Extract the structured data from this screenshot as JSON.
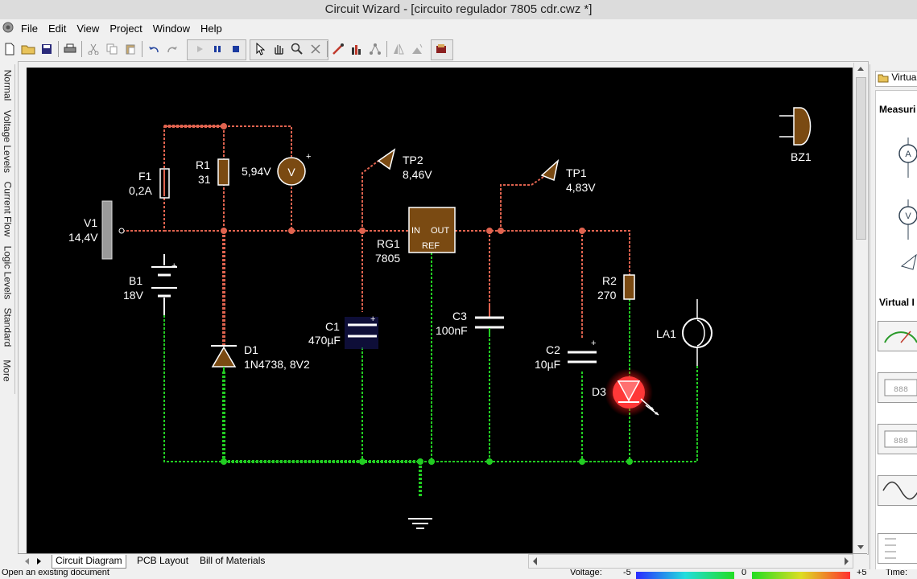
{
  "window": {
    "title": "Circuit Wizard - [circuito regulador 7805 cdr.cwz *]"
  },
  "menu": [
    "File",
    "Edit",
    "View",
    "Project",
    "Window",
    "Help"
  ],
  "left_tabs": [
    "Normal",
    "Voltage Levels",
    "Current Flow",
    "Logic Levels",
    "Standard",
    "More"
  ],
  "sheet_tabs": [
    "Circuit Diagram",
    "PCB Layout",
    "Bill of Materials"
  ],
  "status": {
    "message": "Open an existing document",
    "voltage_label": "Voltage:",
    "scale_min": "-5",
    "scale_mid": "0",
    "scale_max": "+5",
    "time_label": "Time:"
  },
  "right_panel": {
    "header": "Virtual",
    "section_measuring": "Measuri",
    "section_virtual": "Virtual I"
  },
  "circuit": {
    "components": {
      "V1": {
        "name": "V1",
        "value": "14,4V"
      },
      "F1": {
        "name": "F1",
        "value": "0,2A"
      },
      "R1": {
        "name": "R1",
        "value": "31"
      },
      "meter": {
        "reading": "5,94V",
        "symbol": "V"
      },
      "TP2": {
        "name": "TP2",
        "value": "8,46V"
      },
      "TP1": {
        "name": "TP1",
        "value": "4,83V"
      },
      "RG1": {
        "name": "RG1",
        "value": "7805",
        "pin_in": "IN",
        "pin_out": "OUT",
        "pin_ref": "REF"
      },
      "B1": {
        "name": "B1",
        "value": "18V"
      },
      "C1": {
        "name": "C1",
        "value": "470µF"
      },
      "C3": {
        "name": "C3",
        "value": "100nF"
      },
      "C2": {
        "name": "C2",
        "value": "10µF"
      },
      "R2": {
        "name": "R2",
        "value": "270"
      },
      "D1": {
        "name": "D1",
        "value": "1N4738, 8V2"
      },
      "D3": {
        "name": "D3"
      },
      "LA1": {
        "name": "LA1"
      },
      "BZ1": {
        "name": "BZ1"
      }
    }
  },
  "colors": {
    "canvas": "#000000",
    "positive_wire": "#e0634f",
    "ground_wire": "#22cc22",
    "component_brown": "#7a4a12",
    "led_red": "#ff3333"
  }
}
